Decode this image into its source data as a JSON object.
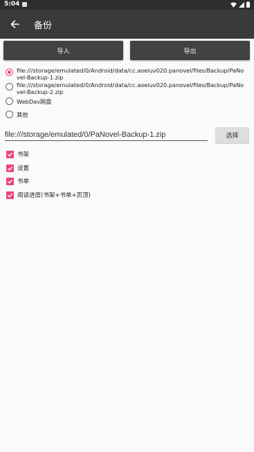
{
  "status_bar": {
    "time": "5:04"
  },
  "toolbar": {
    "title": "备份"
  },
  "actions": {
    "import_label": "导入",
    "export_label": "导出"
  },
  "sources": [
    {
      "label": "file:///storage/emulated/0/Android/data/cc.aoeiuv020.panovel/files/Backup/PaNovel-Backup-1.zip",
      "checked": true
    },
    {
      "label": "file:///storage/emulated/0/Android/data/cc.aoeiuv020.panovel/files/Backup/PaNovel-Backup-2.zip",
      "checked": false
    },
    {
      "label": "WebDav网盘",
      "checked": false
    },
    {
      "label": "其他",
      "checked": false
    }
  ],
  "path": {
    "value": "file:///storage/emulated/0/PaNovel-Backup-1.zip",
    "choose_label": "选择"
  },
  "options": [
    {
      "label": "书架",
      "checked": true
    },
    {
      "label": "设置",
      "checked": true
    },
    {
      "label": "书单",
      "checked": true
    },
    {
      "label": "阅读进度(书架+书单+页顶)",
      "checked": true
    }
  ],
  "colors": {
    "accent": "#e9457b",
    "toolbar": "#3a3a3a",
    "status_bar": "#2d2d2d",
    "button": "#424242"
  }
}
